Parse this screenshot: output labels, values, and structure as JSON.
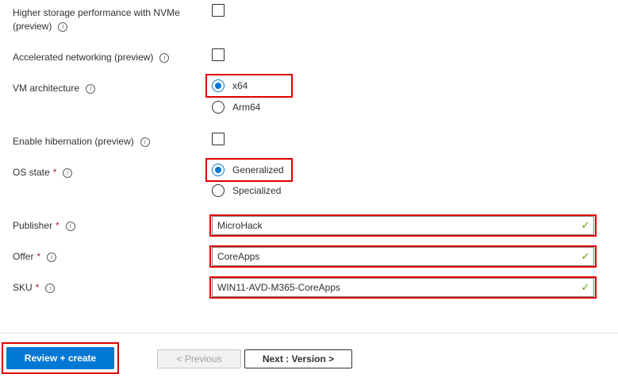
{
  "form": {
    "nvme": {
      "label_line1": "Higher storage performance with NVMe",
      "label_line2": "(preview)"
    },
    "accel_networking": {
      "label": "Accelerated networking (preview)"
    },
    "vm_architecture": {
      "label": "VM architecture",
      "options": [
        "x64",
        "Arm64"
      ],
      "selected": "x64"
    },
    "hibernation": {
      "label": "Enable hibernation (preview)"
    },
    "os_state": {
      "label": "OS state",
      "required_mark": "*",
      "options": [
        "Generalized",
        "Specialized"
      ],
      "selected": "Generalized"
    },
    "publisher": {
      "label": "Publisher",
      "required_mark": "*",
      "value": "MicroHack"
    },
    "offer": {
      "label": "Offer",
      "required_mark": "*",
      "value": "CoreApps"
    },
    "sku": {
      "label": "SKU",
      "required_mark": "*",
      "value": "WIN11-AVD-M365-CoreApps"
    }
  },
  "footer": {
    "review_create_label": "Review + create",
    "previous_label": "< Previous",
    "next_label": "Next : Version >"
  },
  "icons": {
    "info": "info-icon",
    "valid": "checkmark-icon"
  },
  "colors": {
    "accent": "#0078d4",
    "highlight": "#e00000",
    "valid": "#57a300",
    "required": "#a4262c"
  }
}
